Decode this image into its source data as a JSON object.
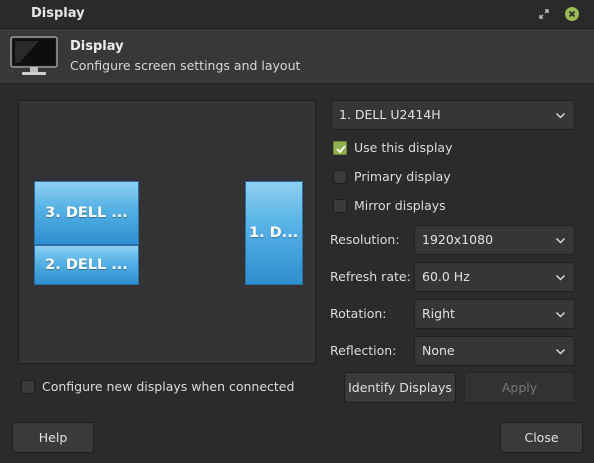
{
  "window": {
    "title": "Display",
    "close_color": "#9bb955"
  },
  "header": {
    "title": "Display",
    "subtitle": "Configure screen settings and layout",
    "icon": "monitor-icon"
  },
  "layout": {
    "monitors": [
      {
        "label": "3. DELL ..."
      },
      {
        "label": "2. DELL ..."
      },
      {
        "label": "1. D..."
      }
    ]
  },
  "monitor_select": {
    "value": "1. DELL U2414H"
  },
  "options": {
    "use_display": {
      "label": "Use this display",
      "checked": true
    },
    "primary_display": {
      "label": "Primary display",
      "checked": false
    },
    "mirror_displays": {
      "label": "Mirror displays",
      "checked": false
    }
  },
  "properties": {
    "resolution": {
      "label": "Resolution:",
      "value": "1920x1080"
    },
    "refresh_rate": {
      "label": "Refresh rate:",
      "value": "60.0 Hz"
    },
    "rotation": {
      "label": "Rotation:",
      "value": "Right"
    },
    "reflection": {
      "label": "Reflection:",
      "value": "None"
    }
  },
  "configure_new": {
    "label": "Configure new displays when connected",
    "checked": false
  },
  "buttons": {
    "identify": "Identify Displays",
    "apply": "Apply",
    "help": "Help",
    "close": "Close"
  },
  "colors": {
    "accent_check": "#8eb04f",
    "monitor_blue": "#58b3e6",
    "background": "#2b2b2b"
  }
}
